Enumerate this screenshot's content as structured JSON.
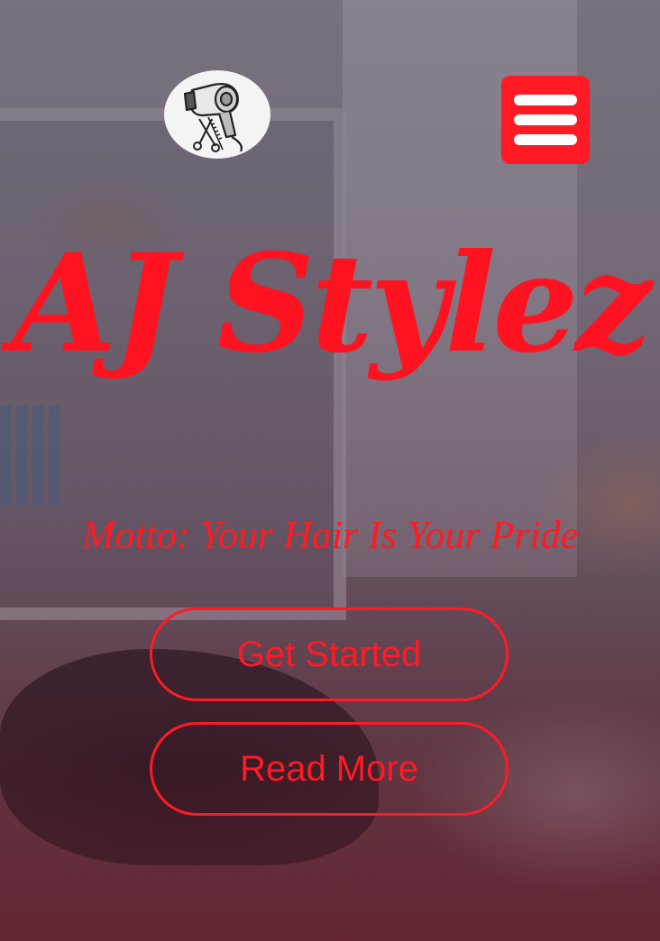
{
  "header": {
    "logo_icon": "hair-dryer-scissors-comb-icon",
    "menu_icon": "hamburger-menu-icon"
  },
  "hero": {
    "title": "AJ Stylez",
    "motto": "Motto: Your Hair Is Your Pride",
    "get_started_label": "Get Started",
    "read_more_label": "Read More"
  },
  "colors": {
    "accent": "#ff1a24",
    "menu_bar": "#ffffff",
    "logo_bg": "#f4f4f4"
  }
}
